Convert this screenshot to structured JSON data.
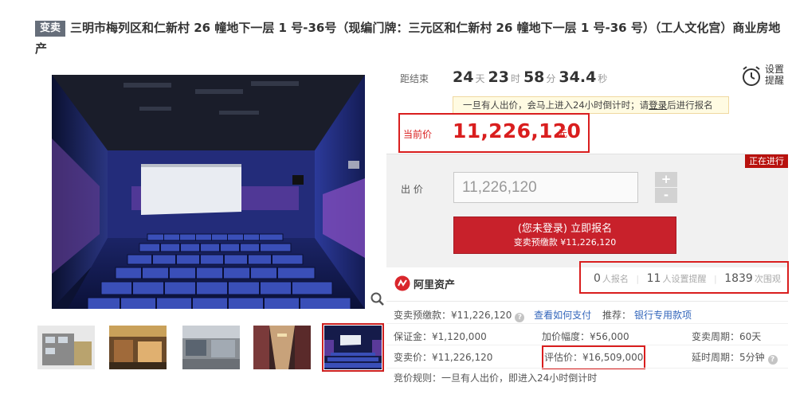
{
  "title": {
    "tag": "变卖",
    "text": "三明市梅列区和仁新村 26 幢地下一层 1 号-36号（现编门牌：三元区和仁新村 26 幢地下一层 1 号-36 号）（工人文化宫）商业房地产"
  },
  "timer": {
    "label": "距结束",
    "days": "24",
    "days_unit": "天",
    "hours": "23",
    "hours_unit": "时",
    "minutes": "58",
    "minutes_unit": "分",
    "seconds": "34.4",
    "seconds_unit": "秒"
  },
  "remind": {
    "line1": "设置",
    "line2": "提醒",
    "icon": "alarm-clock-icon"
  },
  "notice": {
    "prefix": "一旦有人出价，会马上进入24小时倒计时；请",
    "link": "登录",
    "suffix": "后进行报名"
  },
  "current_price": {
    "label": "当前价",
    "value": "11,226,120",
    "unit": "元"
  },
  "bid": {
    "status": "正在进行",
    "label": "出 价",
    "value": "11,226,120",
    "plus": "+",
    "minus": "-",
    "button_main": "(您未登录) 立即报名",
    "button_sub": "变卖预缴款 ¥11,226,120"
  },
  "brand": {
    "name": "阿里资产",
    "icon": "ali-asset-logo-icon"
  },
  "stats": {
    "signups": "0",
    "signups_label": "人报名",
    "reminders": "11",
    "reminders_label": "人设置提醒",
    "views": "1839",
    "views_label": "次围观"
  },
  "info": {
    "deposit": "变卖预缴款：¥11,226,120",
    "how_to_pay": "查看如何支付",
    "recommend_label": "推荐：",
    "recommend_link": "银行专用款项",
    "guarantee": "保证金：¥1,120,000",
    "increment": "加价幅度：¥56,000",
    "period": "变卖周期：60天",
    "sale_price": "变卖价：¥11,226,120",
    "appraisal": "评估价：¥16,509,000",
    "delay": "延时周期：5分钟",
    "rule": "竞价规则：一旦有人出价，即进入24小时倒计时"
  },
  "colors": {
    "accent": "#d91e1e",
    "button": "#c8212b",
    "link": "#3366bb"
  }
}
